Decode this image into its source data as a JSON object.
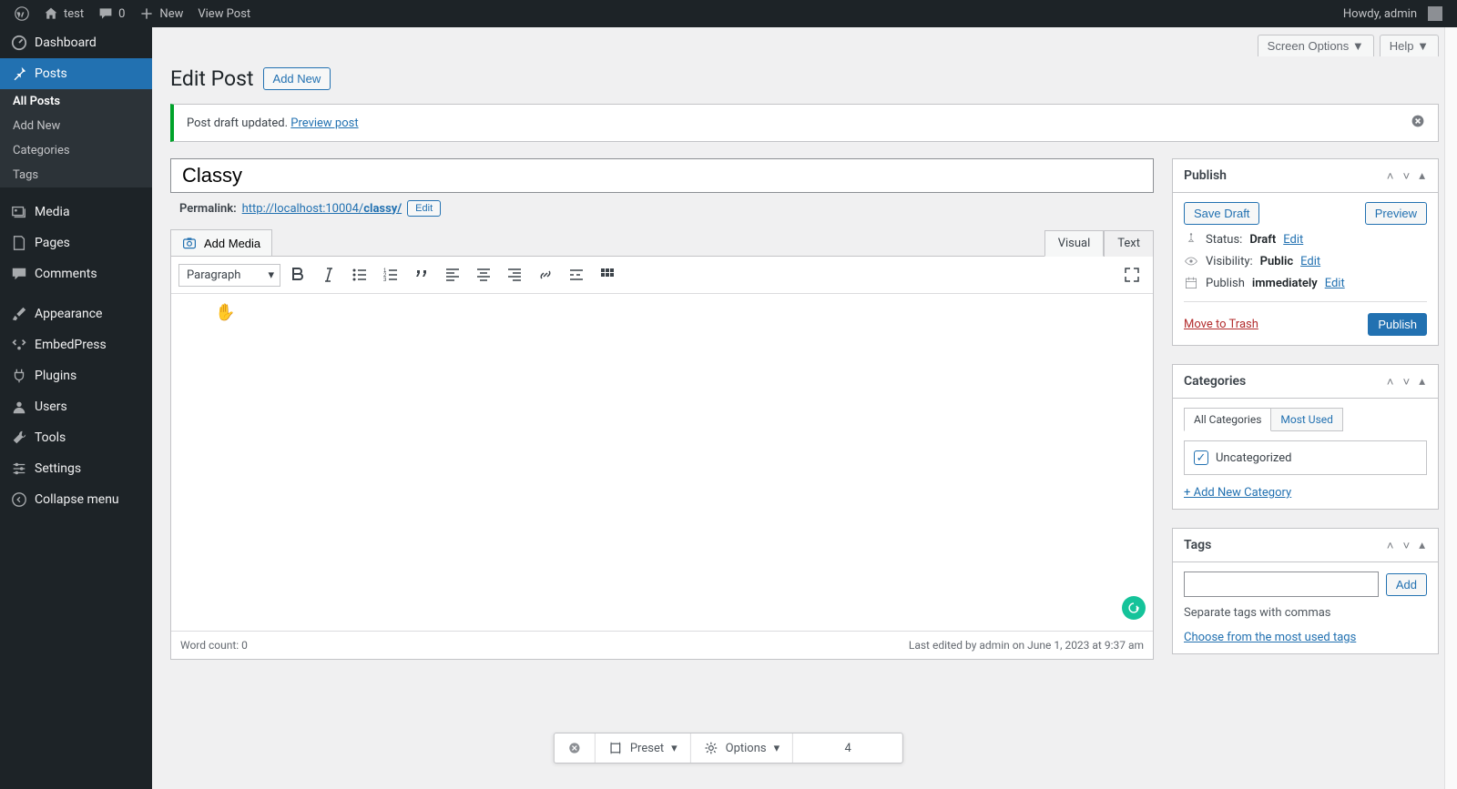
{
  "adminbar": {
    "site_name": "test",
    "comments": "0",
    "new": "New",
    "view_post": "View Post",
    "howdy": "Howdy, admin"
  },
  "sidebar": {
    "dashboard": "Dashboard",
    "posts": "Posts",
    "posts_sub": [
      "All Posts",
      "Add New",
      "Categories",
      "Tags"
    ],
    "media": "Media",
    "pages": "Pages",
    "comments": "Comments",
    "appearance": "Appearance",
    "embedpress": "EmbedPress",
    "plugins": "Plugins",
    "users": "Users",
    "tools": "Tools",
    "settings": "Settings",
    "collapse": "Collapse menu"
  },
  "top_tabs": {
    "screen_options": "Screen Options",
    "help": "Help"
  },
  "heading": "Edit Post",
  "add_new": "Add New",
  "notice": {
    "text": "Post draft updated. ",
    "link": "Preview post"
  },
  "title_value": "Classy",
  "permalink": {
    "label": "Permalink:",
    "base": "http://localhost:10004/",
    "slug": "classy/",
    "edit": "Edit"
  },
  "add_media": "Add Media",
  "editor_tabs": {
    "visual": "Visual",
    "text": "Text"
  },
  "paragraph_label": "Paragraph",
  "word_count": "Word count: 0",
  "last_edited": "Last edited by admin on June 1, 2023 at 9:37 am",
  "publish_box": {
    "title": "Publish",
    "save_draft": "Save Draft",
    "preview": "Preview",
    "status_label": "Status:",
    "status_value": "Draft",
    "visibility_label": "Visibility:",
    "visibility_value": "Public",
    "publish_label": "Publish",
    "publish_value": "immediately",
    "edit": "Edit",
    "trash": "Move to Trash",
    "publish_btn": "Publish"
  },
  "categories_box": {
    "title": "Categories",
    "tab_all": "All Categories",
    "tab_most": "Most Used",
    "item": "Uncategorized",
    "add_new": "+ Add New Category"
  },
  "tags_box": {
    "title": "Tags",
    "add": "Add",
    "hint": "Separate tags with commas",
    "choose": "Choose from the most used tags"
  },
  "bottom_bar": {
    "preset": "Preset",
    "options": "Options",
    "value": "4"
  }
}
